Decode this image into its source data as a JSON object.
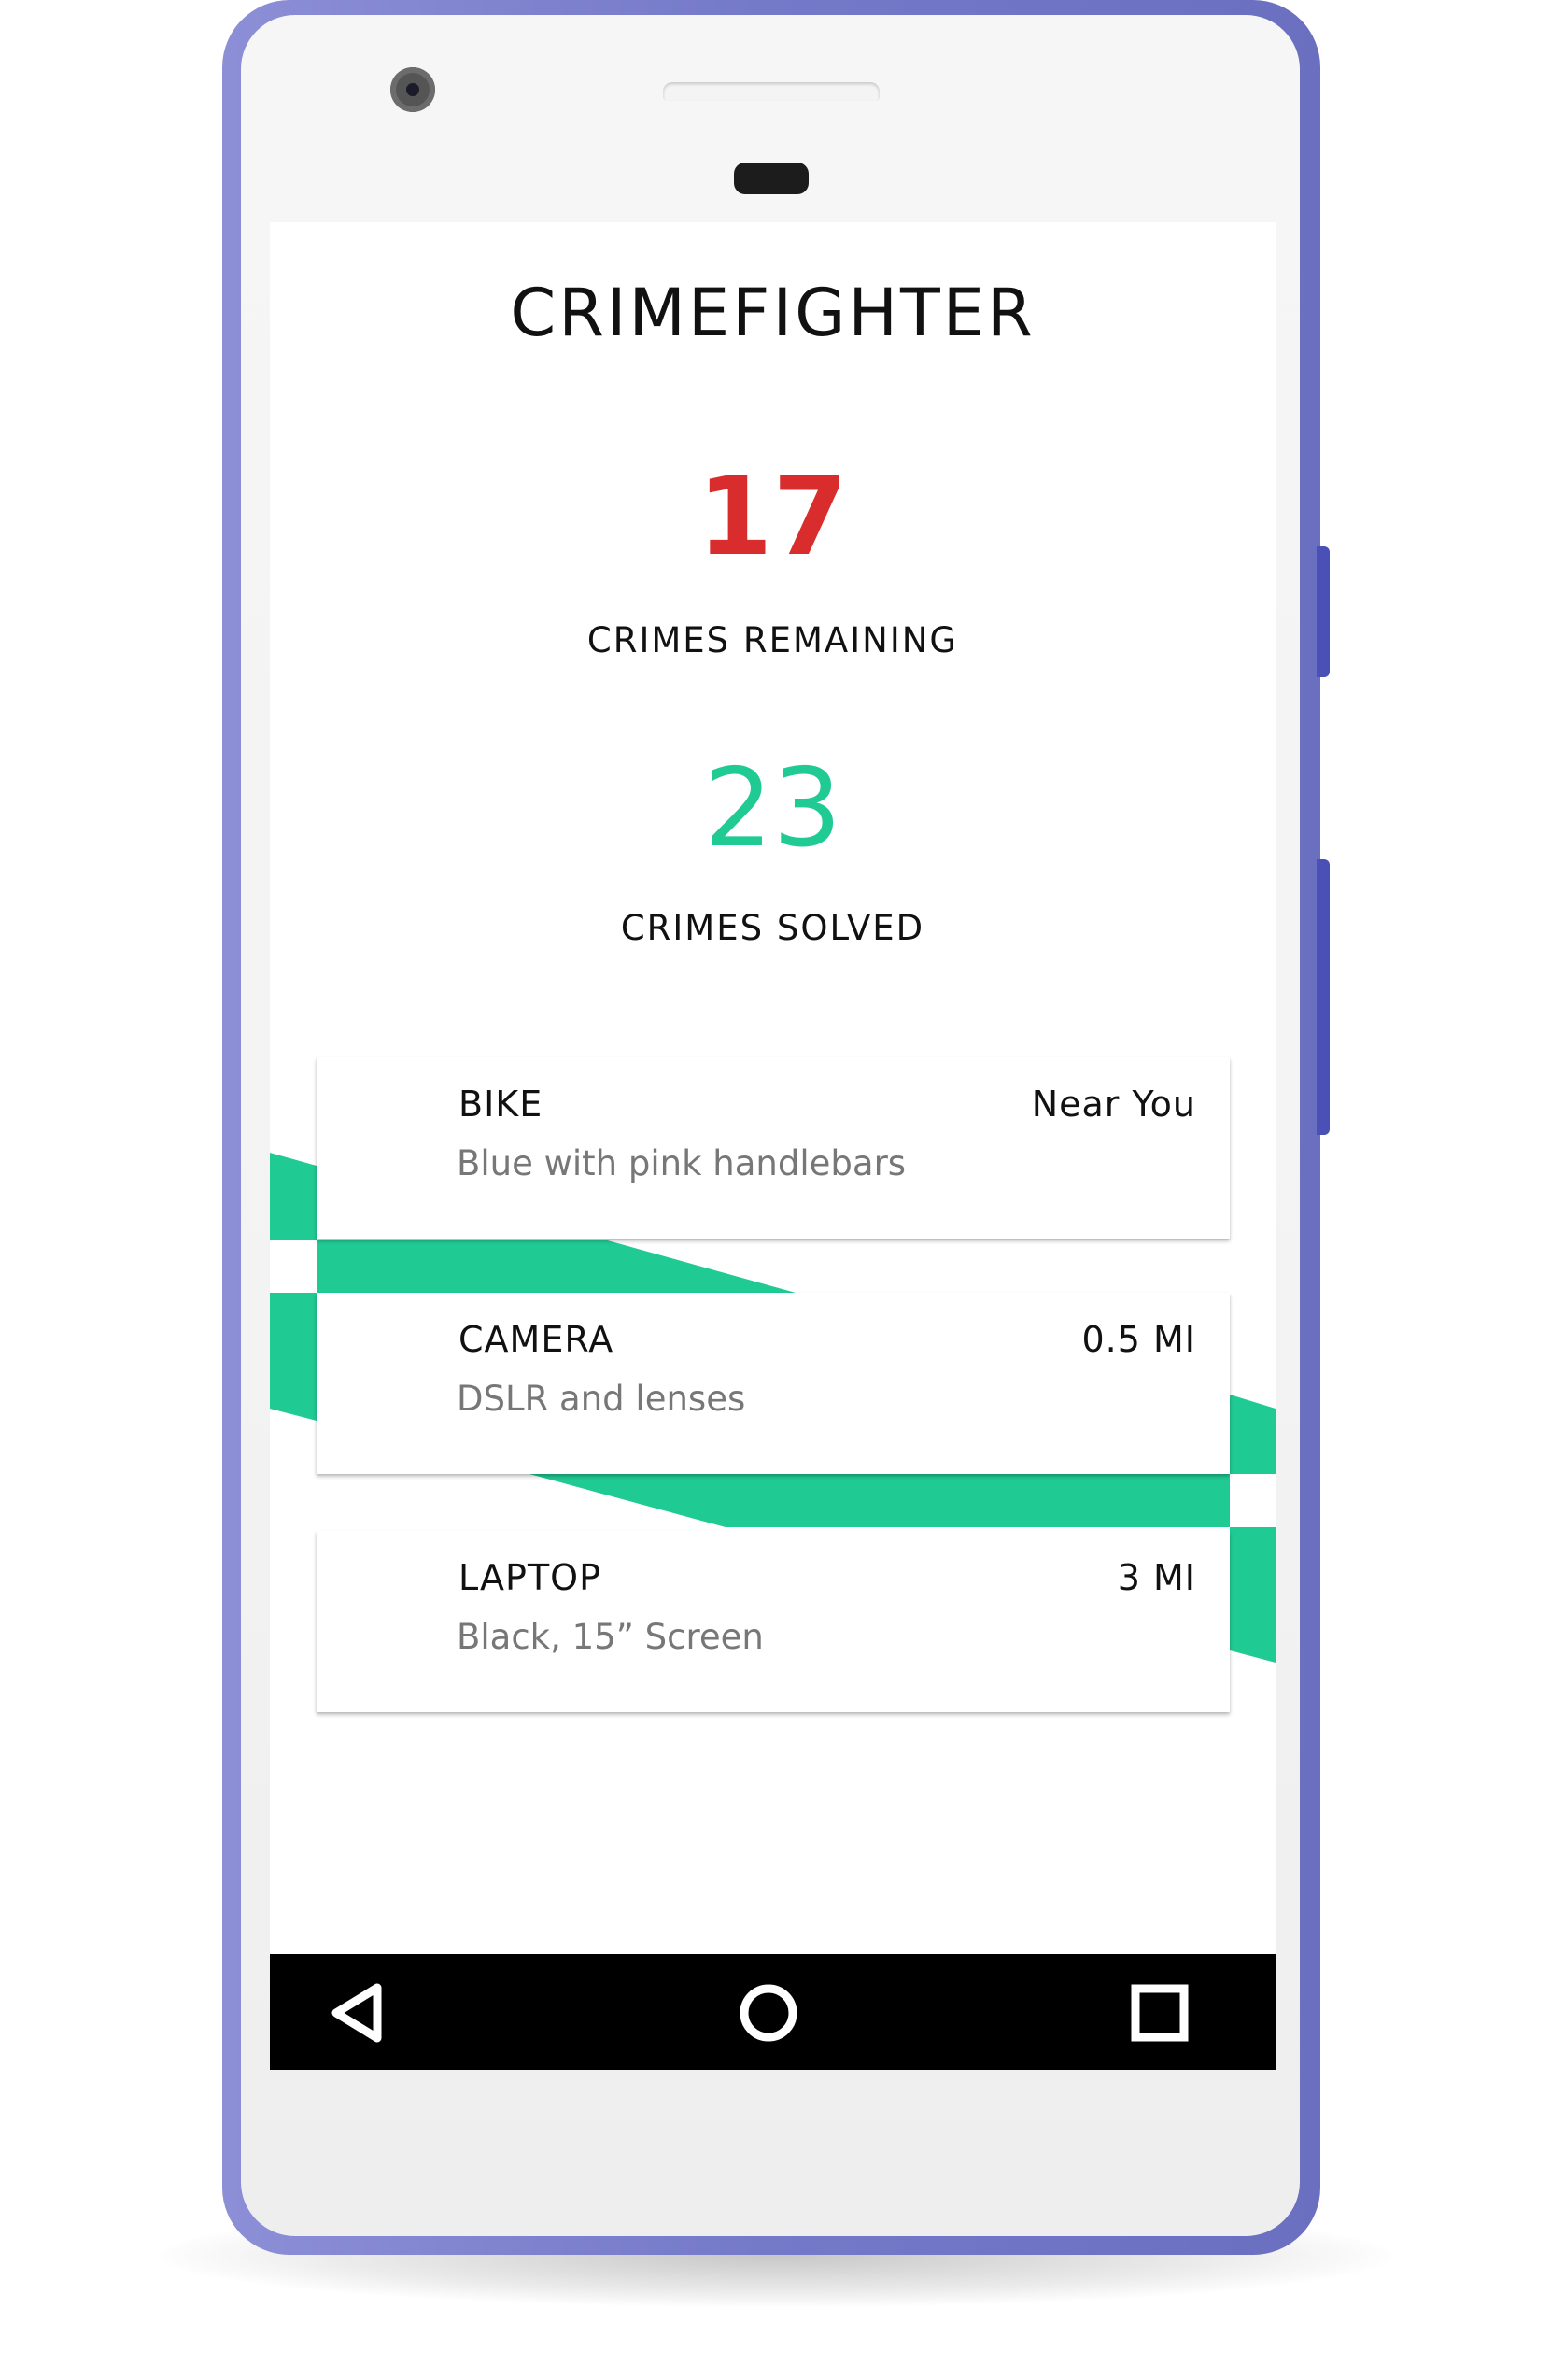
{
  "app": {
    "title": "CRIMEFIGHTER"
  },
  "stats": {
    "remaining_count": "17",
    "remaining_label": "CRIMES REMAINING",
    "solved_count": "23",
    "solved_label": "CRIMES SOLVED"
  },
  "crimes": [
    {
      "name": "BIKE",
      "distance": "Near You",
      "description": "Blue with pink handlebars"
    },
    {
      "name": "CAMERA",
      "distance": "0.5 MI",
      "description": "DSLR and lenses"
    },
    {
      "name": "LAPTOP",
      "distance": "3 MI",
      "description": "Black, 15” Screen"
    }
  ],
  "navbar": {
    "back_icon": "back-triangle-icon",
    "home_icon": "home-circle-icon",
    "recent_icon": "recent-apps-square-icon"
  },
  "colors": {
    "phone_frame": "#7479c8",
    "accent_green": "#20ca93",
    "alert_red": "#d92c2c",
    "navbar_bg": "#000000"
  }
}
